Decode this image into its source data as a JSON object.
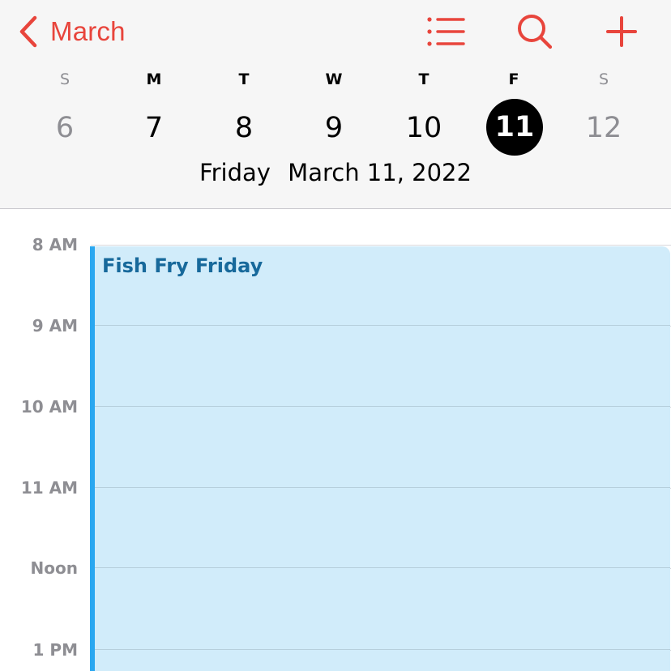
{
  "header": {
    "back_label": "March",
    "accent_color": "#e8453c",
    "icons": [
      "chevron-left-icon",
      "list-icon",
      "search-icon",
      "plus-icon"
    ]
  },
  "week": {
    "days": [
      {
        "letter": "S",
        "date": "6",
        "weekend": true,
        "selected": false
      },
      {
        "letter": "M",
        "date": "7",
        "weekend": false,
        "selected": false
      },
      {
        "letter": "T",
        "date": "8",
        "weekend": false,
        "selected": false
      },
      {
        "letter": "W",
        "date": "9",
        "weekend": false,
        "selected": false
      },
      {
        "letter": "T",
        "date": "10",
        "weekend": false,
        "selected": false
      },
      {
        "letter": "F",
        "date": "11",
        "weekend": false,
        "selected": true
      },
      {
        "letter": "S",
        "date": "12",
        "weekend": true,
        "selected": false
      }
    ],
    "selected_weekday": "Friday",
    "selected_full_date": "March 11, 2022"
  },
  "timeline": {
    "hours": [
      "8 AM",
      "9 AM",
      "10 AM",
      "11 AM",
      "Noon",
      "1 PM"
    ]
  },
  "event": {
    "title": "Fish Fry Friday",
    "color": "#2aa7f0",
    "fill": "#d1ecfa"
  }
}
